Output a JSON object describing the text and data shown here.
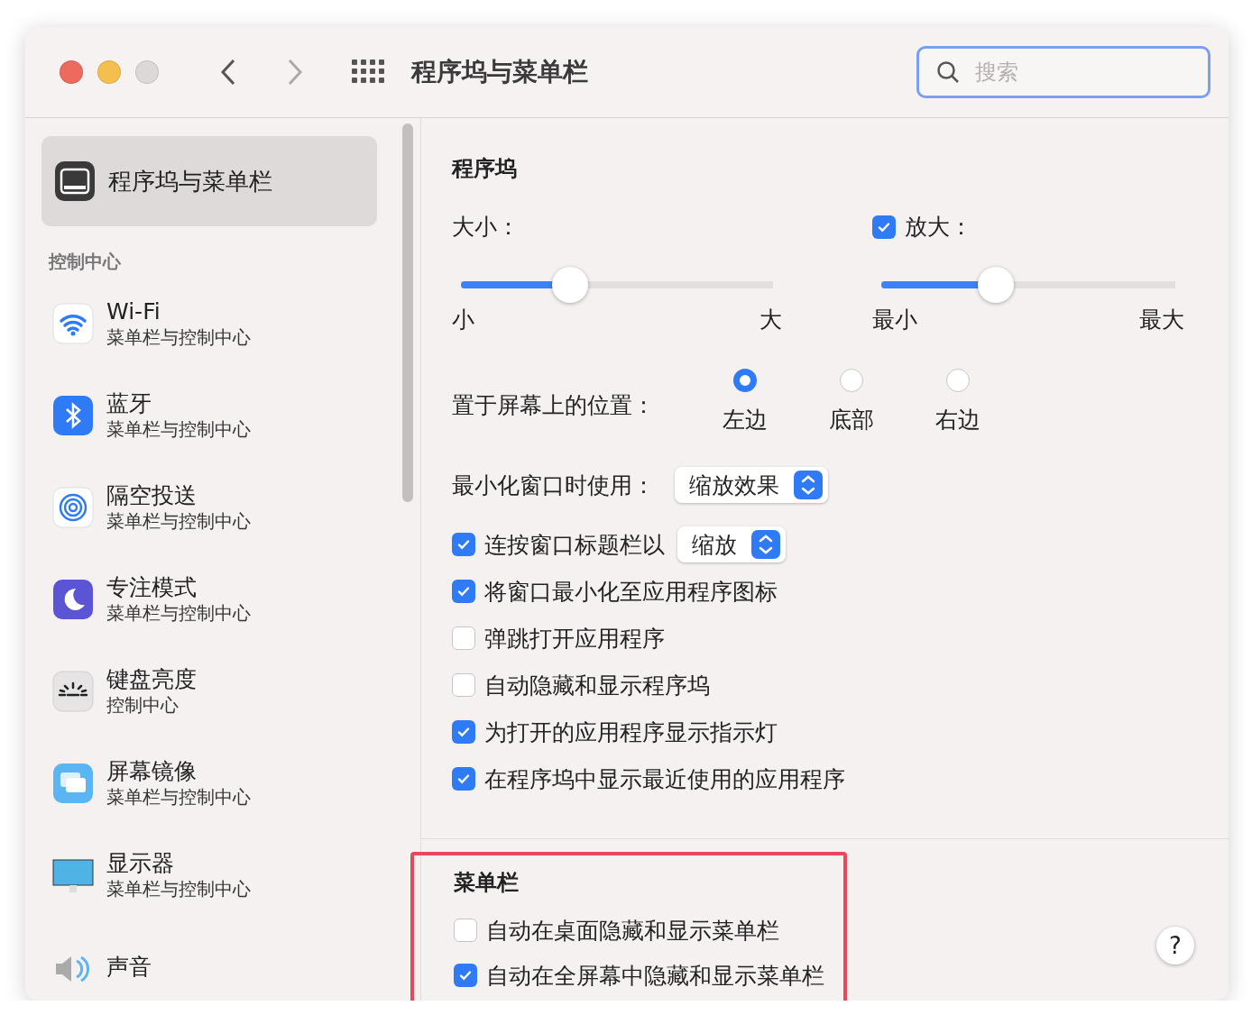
{
  "window": {
    "title": "程序坞与菜单栏"
  },
  "search": {
    "placeholder": "搜索"
  },
  "sidebar": {
    "top_item": {
      "label": "程序坞与菜单栏",
      "selected": true
    },
    "section_title": "控制中心",
    "items": [
      {
        "kind": "wifi",
        "title": "Wi-Fi",
        "subtitle": "菜单栏与控制中心",
        "selected": false
      },
      {
        "kind": "bluetooth",
        "title": "蓝牙",
        "subtitle": "菜单栏与控制中心",
        "selected": false
      },
      {
        "kind": "airdrop",
        "title": "隔空投送",
        "subtitle": "菜单栏与控制中心",
        "selected": false
      },
      {
        "kind": "focus",
        "title": "专注模式",
        "subtitle": "菜单栏与控制中心",
        "selected": false
      },
      {
        "kind": "keyboard",
        "title": "键盘亮度",
        "subtitle": "控制中心",
        "selected": false
      },
      {
        "kind": "mirror",
        "title": "屏幕镜像",
        "subtitle": "菜单栏与控制中心",
        "selected": false
      },
      {
        "kind": "display",
        "title": "显示器",
        "subtitle": "菜单栏与控制中心",
        "selected": false
      },
      {
        "kind": "sound",
        "title": "声音",
        "selected": false
      }
    ]
  },
  "dock": {
    "title": "程序坞",
    "size": {
      "label": "大小：",
      "level": 0.35,
      "min_label": "小",
      "max_label": "大"
    },
    "magnification": {
      "label": "放大：",
      "checked": true,
      "level": 0.39,
      "min_label": "最小",
      "max_label": "最大"
    },
    "position": {
      "label": "置于屏幕上的位置：",
      "options": [
        {
          "label": "左边",
          "selected": true
        },
        {
          "label": "底部",
          "selected": false
        },
        {
          "label": "右边",
          "selected": false
        }
      ]
    },
    "minimize": {
      "label": "最小化窗口时使用：",
      "value": "缩放效果"
    },
    "options": [
      {
        "label": "连按窗口标题栏以",
        "checked": true,
        "popup": "缩放"
      },
      {
        "label": "将窗口最小化至应用程序图标",
        "checked": true
      },
      {
        "label": "弹跳打开应用程序",
        "checked": false
      },
      {
        "label": "自动隐藏和显示程序坞",
        "checked": false
      },
      {
        "label": "为打开的应用程序显示指示灯",
        "checked": true
      },
      {
        "label": "在程序坞中显示最近使用的应用程序",
        "checked": true
      }
    ]
  },
  "menu_bar": {
    "title": "菜单栏",
    "highlighted": true,
    "options": [
      {
        "label": "自动在桌面隐藏和显示菜单栏",
        "checked": false
      },
      {
        "label": "自动在全屏幕中隐藏和显示菜单栏",
        "checked": true
      }
    ]
  },
  "help_button": "?"
}
